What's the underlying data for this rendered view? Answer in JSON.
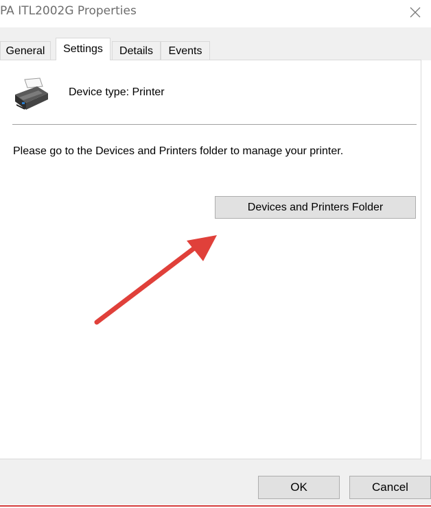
{
  "window": {
    "title": "PA ITL2002G Properties",
    "close_symbol": "✕"
  },
  "tabs": [
    {
      "label": "General",
      "active": false
    },
    {
      "label": "Settings",
      "active": true
    },
    {
      "label": "Details",
      "active": false
    },
    {
      "label": "Events",
      "active": false
    }
  ],
  "settings": {
    "icon": "printer-icon",
    "device_type": "Device type: Printer",
    "message": "Please go to the Devices and Printers folder to manage your printer.",
    "folder_button": "Devices and Printers Folder"
  },
  "annotation": {
    "arrow_color": "#e0403a"
  },
  "footer": {
    "ok_label": "OK",
    "cancel_label": "Cancel"
  }
}
